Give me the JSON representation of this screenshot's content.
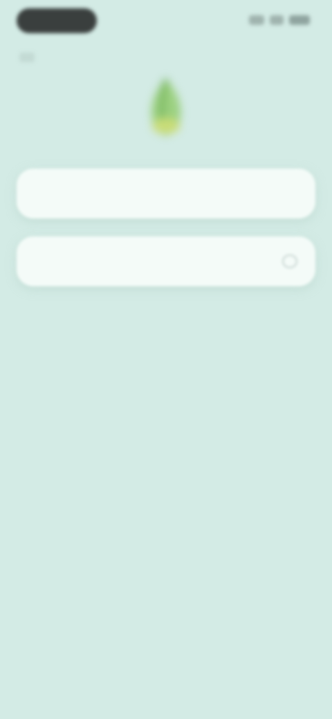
{
  "login_form": {
    "name_placeholder": "",
    "password_placeholder": ""
  },
  "icons": {
    "logo": "app-logo-leaf",
    "password_toggle": "eye-icon"
  },
  "colors": {
    "background": "#d3ebe5",
    "field_background": "#f4fbf8",
    "logo_green": "#8cc870"
  }
}
